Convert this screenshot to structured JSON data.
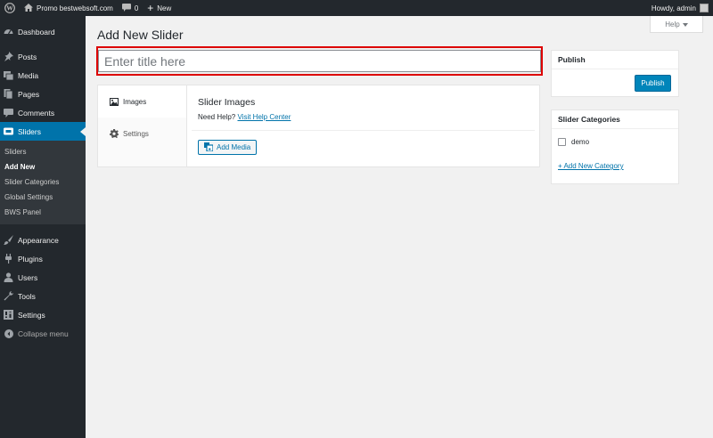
{
  "adminbar": {
    "site_name": "Promo bestwebsoft.com",
    "comments_count": "0",
    "new_label": "New",
    "greeting": "Howdy, admin"
  },
  "sidebar": {
    "items": [
      {
        "label": "Dashboard",
        "icon": "dashboard-icon"
      },
      {
        "label": "Posts",
        "icon": "pin-icon"
      },
      {
        "label": "Media",
        "icon": "media-icon"
      },
      {
        "label": "Pages",
        "icon": "pages-icon"
      },
      {
        "label": "Comments",
        "icon": "comment-icon"
      },
      {
        "label": "Sliders",
        "icon": "slider-icon"
      }
    ],
    "submenu": [
      "Sliders",
      "Add New",
      "Slider Categories",
      "Global Settings",
      "BWS Panel"
    ],
    "items2": [
      {
        "label": "Appearance",
        "icon": "brush-icon"
      },
      {
        "label": "Plugins",
        "icon": "plug-icon"
      },
      {
        "label": "Users",
        "icon": "user-icon"
      },
      {
        "label": "Tools",
        "icon": "wrench-icon"
      },
      {
        "label": "Settings",
        "icon": "settings-icon"
      }
    ],
    "collapse": "Collapse menu"
  },
  "header": {
    "title": "Add New Slider",
    "help": "Help"
  },
  "title_input": {
    "placeholder": "Enter title here",
    "value": ""
  },
  "tabs": [
    {
      "label": "Images",
      "icon": "image-icon"
    },
    {
      "label": "Settings",
      "icon": "gear-icon"
    }
  ],
  "panel": {
    "title": "Slider Images",
    "help_prefix": "Need Help?",
    "help_link": "Visit Help Center",
    "add_media": "Add Media"
  },
  "publish": {
    "title": "Publish",
    "button": "Publish"
  },
  "categories": {
    "title": "Slider Categories",
    "items": [
      {
        "label": "demo",
        "checked": false
      }
    ],
    "add_link": "+ Add New Category"
  },
  "colors": {
    "accent": "#0073aa",
    "sidebar_bg": "#23282d",
    "highlight": "#dd0000"
  }
}
